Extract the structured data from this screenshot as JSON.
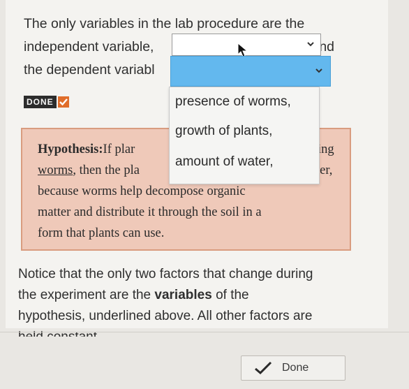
{
  "question": {
    "line1": "The only variables in the lab procedure are the",
    "line2_start": "independent variable,",
    "line2_end": "and",
    "line3_start": "the dependent variabl"
  },
  "dropdown1": {
    "selected": ""
  },
  "dropdown2": {
    "selected": ""
  },
  "done_badge": {
    "label": "DONE"
  },
  "dropdown_menu": {
    "options": [
      "presence of worms,",
      "growth of plants,",
      "amount of water,"
    ]
  },
  "hypothesis": {
    "label": "Hypothesis:",
    "line1_start": "If plar",
    "line1_end": "ing",
    "line2_underlined": "worms",
    "line2_start": ", then the pla",
    "line2_end": "ter,",
    "line3": "because worms help decompose organic",
    "line4": "matter and distribute it through the soil in a",
    "line5": "form that plants can use."
  },
  "notice": {
    "line1": "Notice that the only two factors that change during",
    "line2_start": "the experiment are the ",
    "line2_bold": "variables",
    "line2_end": " of the",
    "line3": "hypothesis, underlined above. All other factors are",
    "line4": "held constant"
  },
  "footer": {
    "done_button": "Done"
  },
  "colors": {
    "accent_blue": "#63b8ee",
    "hypothesis_bg": "#efc9b9",
    "done_check": "#e06d2a"
  }
}
